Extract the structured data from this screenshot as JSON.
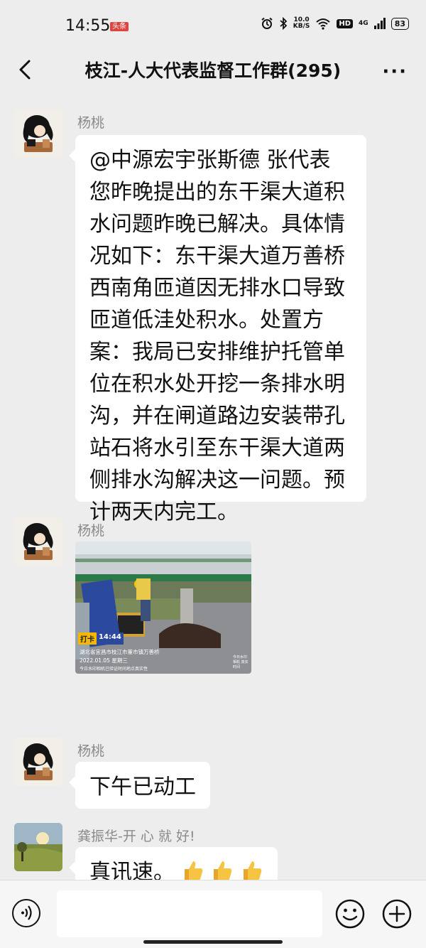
{
  "status_bar": {
    "time": "14:55",
    "badge": "头条",
    "net_speed_value": "10.0",
    "net_speed_unit": "KB/S",
    "hd": "HD",
    "signal": "4G",
    "battery": "83",
    "icons": [
      "alarm-icon",
      "bluetooth-icon",
      "wifi-icon",
      "signal-icon"
    ]
  },
  "header": {
    "back_icon": "chevron-left-icon",
    "title": "枝江-人大代表监督工作群(295)",
    "more_icon": "more-dots-icon",
    "more_label": "···"
  },
  "messages": [
    {
      "sender": "杨桃",
      "text": "@中源宏宇张斯德 张代表您昨晚提出的东干渠大道积水问题昨晚已解决。具体情况如下：东干渠大道万善桥西南角匝道因无排水口导致匝道低洼处积水。处置方案：我局已安排维护托管单位在积水处开挖一条排水明沟，并在闸道路边安装带孔站石将水引至东干渠大道两侧排水沟解决这一问题。预计两天内完工。",
      "lines": [
        "@中源宏宇张斯德  张代表",
        "您昨晚提出的东干渠大道积",
        "水问题昨晚已解决。具体情",
        "况如下：东干渠大道万善桥",
        "西南角匝道因无排水口导致",
        "匝道低洼处积水。处置方",
        "案：我局已安排维护托管单",
        "位在积水处开挖一条排水明",
        "沟，并在闸道路边安装带孔",
        "站石将水引至东干渠大道两",
        "侧排水沟解决这一问题。预",
        "计两天内完工。"
      ]
    },
    {
      "sender": "杨桃",
      "photo": {
        "punch_label": "打卡",
        "punch_time": "14:44",
        "location": "湖北省宜昌市枝江市董市镇万善桥",
        "date": "2022.01.05 星期三",
        "footer": "今日水印相机已验证时间地点真实性",
        "watermark": "今日水印 相机 真实时间"
      }
    },
    {
      "sender": "杨桃",
      "text": "下午已动工"
    },
    {
      "sender": "龚振华-开 心 就 好!",
      "text": "真讯速。",
      "emojis": [
        "thumbs-up-icon",
        "thumbs-up-icon",
        "thumbs-up-icon"
      ]
    }
  ],
  "input_bar": {
    "voice_icon": "voice-icon",
    "emoji_icon": "smiley-icon",
    "plus_icon": "plus-icon",
    "input_value": ""
  }
}
